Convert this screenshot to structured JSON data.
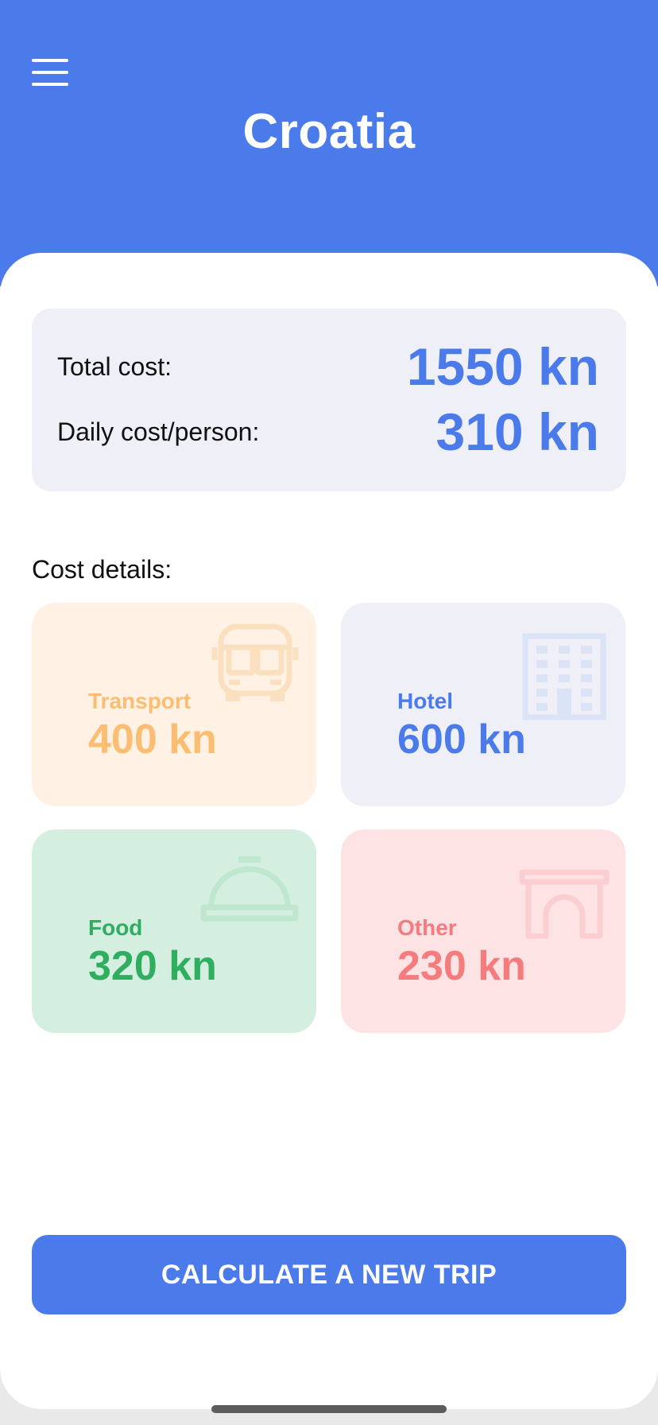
{
  "header": {
    "title": "Croatia",
    "menu_icon": "hamburger-menu-icon",
    "background_color": "#4b7bea"
  },
  "summary": {
    "total_label": "Total cost:",
    "total_value": "1550 kn",
    "daily_label": "Daily cost/person:",
    "daily_value": "310 kn"
  },
  "details": {
    "section_label": "Cost details:",
    "cards": [
      {
        "label": "Transport",
        "value": "400 kn",
        "icon": "bus-icon",
        "color": "#fbbd72",
        "background": "#fff1e3"
      },
      {
        "label": "Hotel",
        "value": "600 kn",
        "icon": "hotel-building-icon",
        "color": "#4b7bea",
        "background": "#efeff8"
      },
      {
        "label": "Food",
        "value": "320 kn",
        "icon": "food-cloche-icon",
        "color": "#2fae5f",
        "background": "#d4eee0"
      },
      {
        "label": "Other",
        "value": "230 kn",
        "icon": "arch-monument-icon",
        "color": "#f57b7d",
        "background": "#fde3e4"
      }
    ]
  },
  "cta": {
    "label": "CALCULATE A NEW TRIP"
  }
}
